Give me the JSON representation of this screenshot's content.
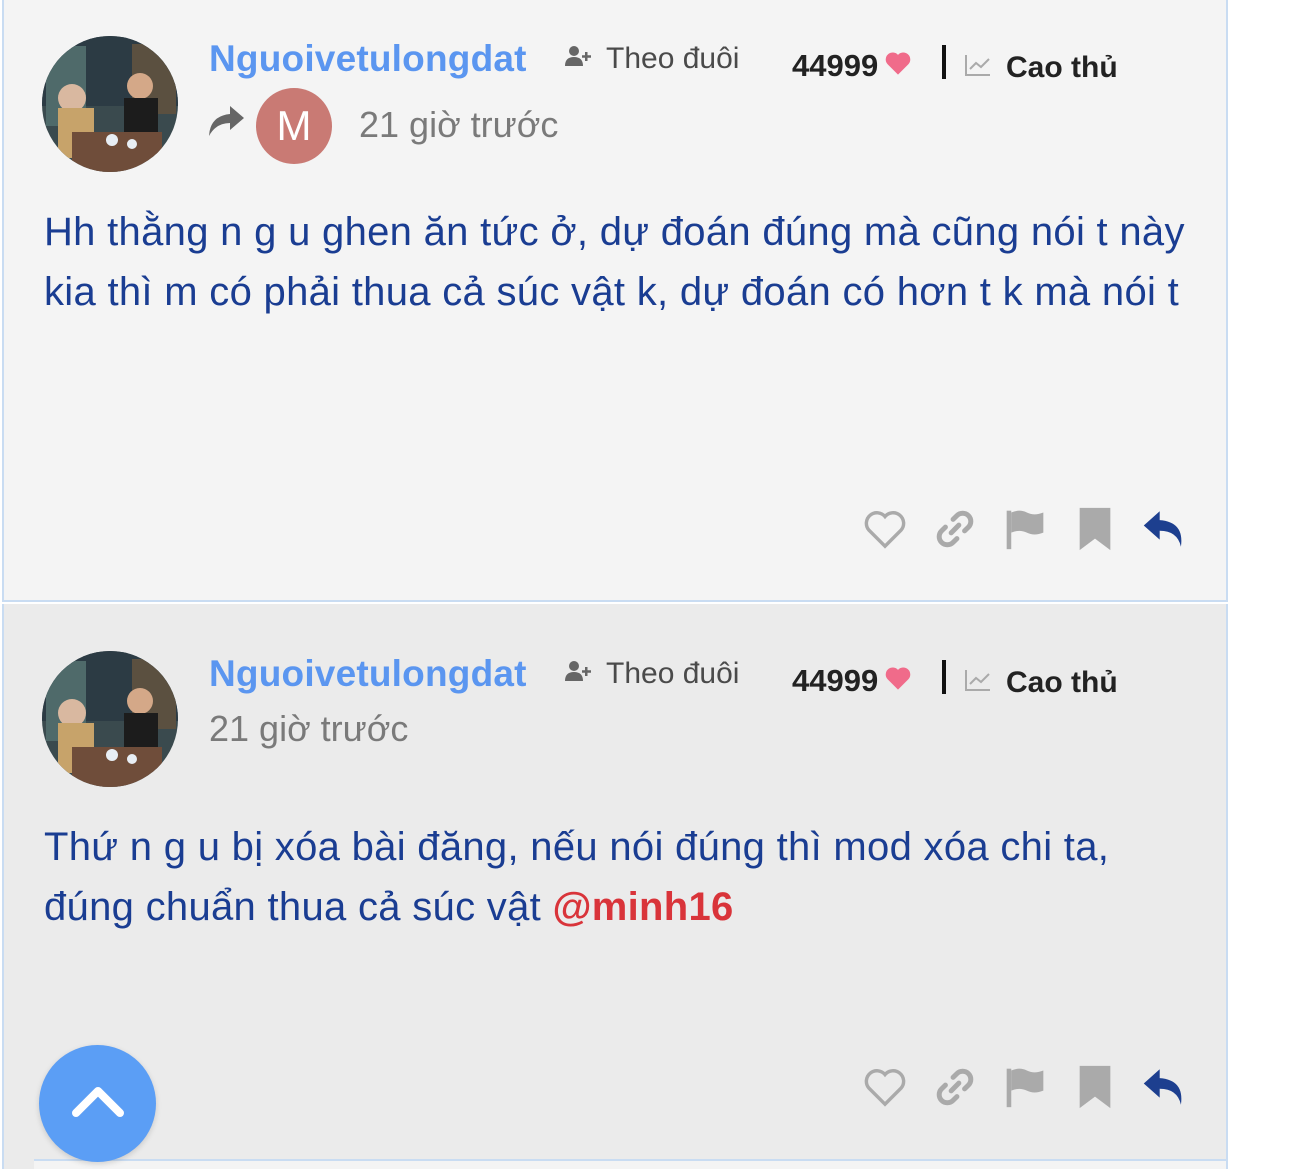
{
  "posts": [
    {
      "username": "Nguoivetulongdat",
      "follow_label": "Theo đuôi",
      "score": "44999",
      "rank": "Cao thủ",
      "shared_from_initial": "M",
      "time": "21 giờ trước",
      "content": "Hh thằng n g u ghen ăn tức ở, dự đoán đúng mà cũng nói t này kia thì m có phải thua cả súc vật k, dự đoán có hơn t k mà nói t"
    },
    {
      "username": "Nguoivetulongdat",
      "follow_label": "Theo đuôi",
      "score": "44999",
      "rank": "Cao thủ",
      "time": "21 giờ trước",
      "content": "Thứ n g u bị xóa bài đăng, nếu nói đúng thì mod xóa chi ta, đúng chuẩn thua cả súc vật ",
      "mention": "@minh16"
    }
  ],
  "icons": {
    "follow": "user-plus-icon",
    "heart": "heart-icon",
    "rank": "chart-line-icon",
    "share": "share-arrow-icon",
    "like": "heart-outline-icon",
    "link": "link-icon",
    "flag": "flag-icon",
    "bookmark": "bookmark-icon",
    "reply": "reply-icon",
    "scroll_top": "chevron-up-icon"
  },
  "colors": {
    "username": "#5b96f0",
    "content": "#1a3d92",
    "mention": "#d9343a",
    "heart": "#f06b8a",
    "reply": "#1d3f8f",
    "scroll_top": "#5b9ef5"
  }
}
